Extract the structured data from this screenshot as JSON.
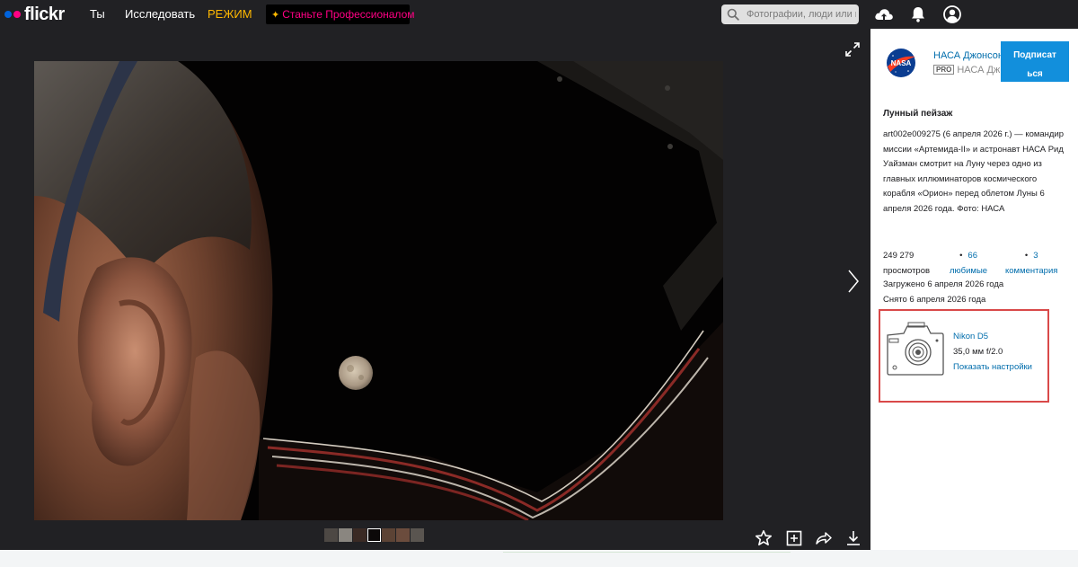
{
  "header": {
    "logo": "flickr",
    "nav": [
      "Ты",
      "Исследовать",
      "РЕЖИМ"
    ],
    "pro_button": "Станьте Профессионалом",
    "search_placeholder": "Фотографии, люди или гр",
    "icons": [
      "upload-icon",
      "bell-icon",
      "user-icon"
    ],
    "colors": {
      "bar": "#212124",
      "mode": "#ffb800",
      "pro": "#ff0084",
      "logo_blue": "#0063dc",
      "logo_pink": "#ff0084"
    }
  },
  "viewer": {
    "icons": [
      "expand-icon",
      "chevron-right-icon"
    ],
    "actions": [
      "star-icon",
      "add-to-album-icon",
      "share-icon",
      "download-icon"
    ]
  },
  "owner": {
    "name": "НАСА Джонсон",
    "pro_badge": "PRO",
    "sub": "НАСА Дж...",
    "avatar": "nasa-logo",
    "subscribe": "Подписат ься"
  },
  "photo": {
    "title": "Лунный пейзаж",
    "description": "art002e009275 (6 апреля 2026 г.) — командир миссии «Артемида-II» и астронавт НАСА Рид Уайзман смотрит на Луну через одно из главных иллюминаторов космического корабля «Орион» перед облетом Луны 6 апреля 2026 года. Фото: НАСА",
    "views": {
      "count": "249 279",
      "label": "просмотров"
    },
    "faves": {
      "count": "66",
      "label": "любимые"
    },
    "comments": {
      "count": "3",
      "label": "комментария"
    },
    "uploaded": "Загружено 6 апреля 2026 года",
    "taken": "Снято 6 апреля 2026 года"
  },
  "camera": {
    "model": "Nikon D5",
    "lens": "35,0 мм f/2.0",
    "settings_link": "Показать настройки",
    "highlight_color": "#d94949"
  }
}
